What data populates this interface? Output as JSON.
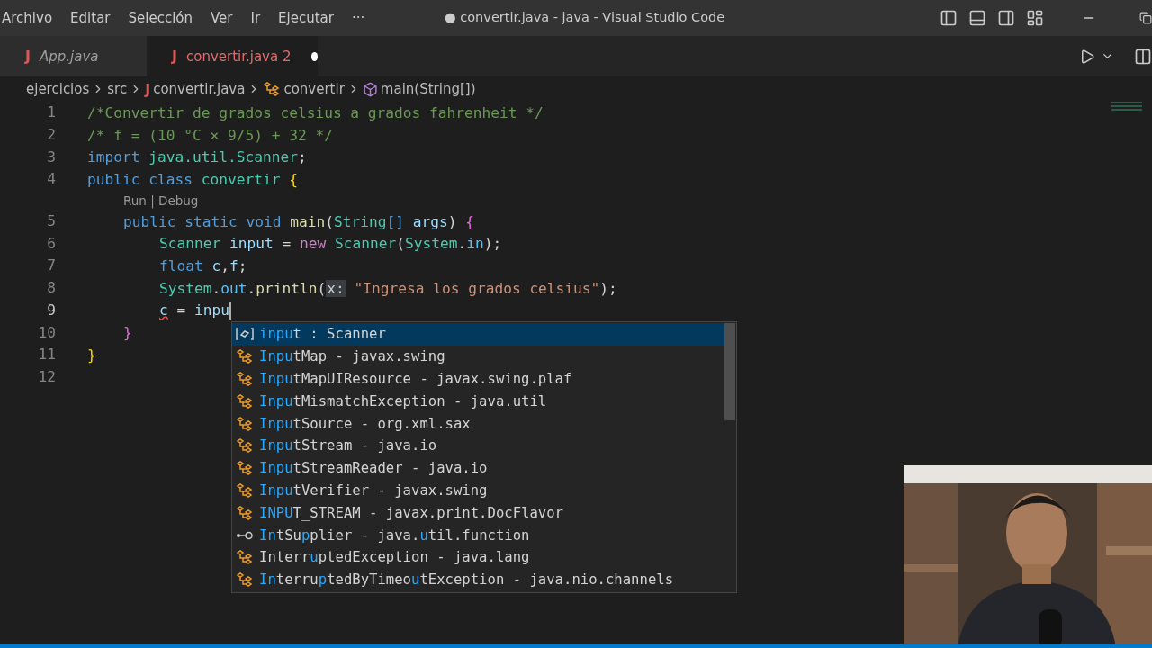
{
  "menu": [
    "Archivo",
    "Editar",
    "Selección",
    "Ver",
    "Ir",
    "Ejecutar",
    "···"
  ],
  "window": {
    "title": "● convertir.java - java - Visual Studio Code"
  },
  "tabs": [
    {
      "icon": "J",
      "label": "App.java",
      "selected": false,
      "modified": false
    },
    {
      "icon": "J",
      "label": "convertir.java",
      "badge": "2",
      "selected": true,
      "modified": true
    }
  ],
  "breadcrumbs": [
    {
      "label": "ejercicios",
      "kind": "folder"
    },
    {
      "label": "src",
      "kind": "folder"
    },
    {
      "icon": "J",
      "label": "convertir.java",
      "kind": "file"
    },
    {
      "label": "convertir",
      "kind": "class"
    },
    {
      "label": "main(String[])",
      "kind": "method"
    }
  ],
  "code": [
    {
      "number": "1",
      "tokens": [
        {
          "t": "/*Convertir de grados celsius a grados fahrenheit */",
          "kind": "comment"
        }
      ]
    },
    {
      "number": "2",
      "tokens": [
        {
          "t": "/* f = (10 °C × 9/5) + 32 */",
          "kind": "comment"
        }
      ]
    },
    {
      "number": "3",
      "tokens": [
        {
          "t": "import ",
          "kind": "keyword"
        },
        {
          "t": "java.util.Scanner",
          "kind": "type"
        },
        {
          "t": ";",
          "kind": "plain"
        }
      ]
    },
    {
      "number": "4",
      "tokens": [
        {
          "t": "public class ",
          "kind": "keyword"
        },
        {
          "t": "convertir ",
          "kind": "type"
        },
        {
          "t": "{",
          "kind": "brace"
        }
      ],
      "children": [
        {
          "codelens": "Run | Debug"
        },
        {
          "number": "5",
          "tokens": [
            {
              "t": "public static void ",
              "kind": "keyword"
            },
            {
              "t": "main",
              "kind": "func"
            },
            {
              "t": "(",
              "kind": "plain"
            },
            {
              "t": "String",
              "kind": "type"
            },
            {
              "t": "[] ",
              "kind": "keyword"
            },
            {
              "t": "args",
              "kind": "var"
            },
            {
              "t": ") ",
              "kind": "plain"
            },
            {
              "t": "{",
              "kind": "brace2"
            }
          ],
          "children": [
            {
              "number": "6",
              "tokens": [
                {
                  "t": "Scanner ",
                  "kind": "type"
                },
                {
                  "t": "input",
                  "kind": "var"
                },
                {
                  "t": " = ",
                  "kind": "plain"
                },
                {
                  "t": "new ",
                  "kind": "control"
                },
                {
                  "t": "Scanner",
                  "kind": "type"
                },
                {
                  "t": "(",
                  "kind": "plain"
                },
                {
                  "t": "System",
                  "kind": "type"
                },
                {
                  "t": ".",
                  "kind": "plain"
                },
                {
                  "t": "in",
                  "kind": "const"
                },
                {
                  "t": ");",
                  "kind": "plain"
                }
              ]
            },
            {
              "number": "7",
              "tokens": [
                {
                  "t": "float ",
                  "kind": "keyword"
                },
                {
                  "t": "c",
                  "kind": "var"
                },
                {
                  "t": ",",
                  "kind": "plain"
                },
                {
                  "t": "f",
                  "kind": "var"
                },
                {
                  "t": ";",
                  "kind": "plain"
                }
              ]
            },
            {
              "number": "8",
              "tokens": [
                {
                  "t": "System",
                  "kind": "type"
                },
                {
                  "t": ".",
                  "kind": "plain"
                },
                {
                  "t": "out",
                  "kind": "const"
                },
                {
                  "t": ".",
                  "kind": "plain"
                },
                {
                  "t": "println",
                  "kind": "func"
                },
                {
                  "t": "(",
                  "kind": "plain"
                },
                {
                  "t": "x:",
                  "kind": "hint"
                },
                {
                  "t": " \"Ingresa los grados celsius\"",
                  "kind": "string"
                },
                {
                  "t": ");",
                  "kind": "plain"
                }
              ]
            },
            {
              "number": "9",
              "current": true,
              "tokens": [
                {
                  "t": "c",
                  "kind": "error"
                },
                {
                  "t": " = ",
                  "kind": "plain"
                },
                {
                  "t": "inpu",
                  "kind": "var"
                }
              ]
            }
          ]
        },
        {
          "number": "10",
          "tokens": [
            {
              "t": "}",
              "kind": "brace2"
            }
          ]
        }
      ]
    },
    {
      "number": "11",
      "tokens": [
        {
          "t": "}",
          "kind": "brace"
        }
      ]
    },
    {
      "number": "12"
    }
  ],
  "suggestions": [
    {
      "label": "**inpu**t : Scanner",
      "kind": "variable",
      "selected": true
    },
    {
      "label": "**Inpu**tMap - javax.swing",
      "kind": "class",
      "selected": false
    },
    {
      "label": "**Inpu**tMapUIResource - javax.swing.plaf",
      "kind": "class",
      "selected": false
    },
    {
      "label": "**Inpu**tMismatchException - java.util",
      "kind": "class",
      "selected": false
    },
    {
      "label": "**Inpu**tSource - org.xml.sax",
      "kind": "class",
      "selected": false
    },
    {
      "label": "**Inpu**tStream - java.io",
      "kind": "class",
      "selected": false
    },
    {
      "label": "**Inpu**tStreamReader - java.io",
      "kind": "class",
      "selected": false
    },
    {
      "label": "**Inpu**tVerifier - javax.swing",
      "kind": "class",
      "selected": false
    },
    {
      "label": "**INPU**T_STREAM - javax.print.DocFlavor",
      "kind": "class",
      "selected": false
    },
    {
      "label": "**In**tSu**p**plier - java.**u**til.function",
      "kind": "interface",
      "selected": false
    },
    {
      "label": "Interr**u**ptedException - java.lang",
      "kind": "class",
      "selected": false
    },
    {
      "label": "**In**terru**p**tedByTimeo**u**tException - java.nio.channels",
      "kind": "class",
      "selected": false
    }
  ],
  "webcam": {
    "kind": "picture"
  }
}
